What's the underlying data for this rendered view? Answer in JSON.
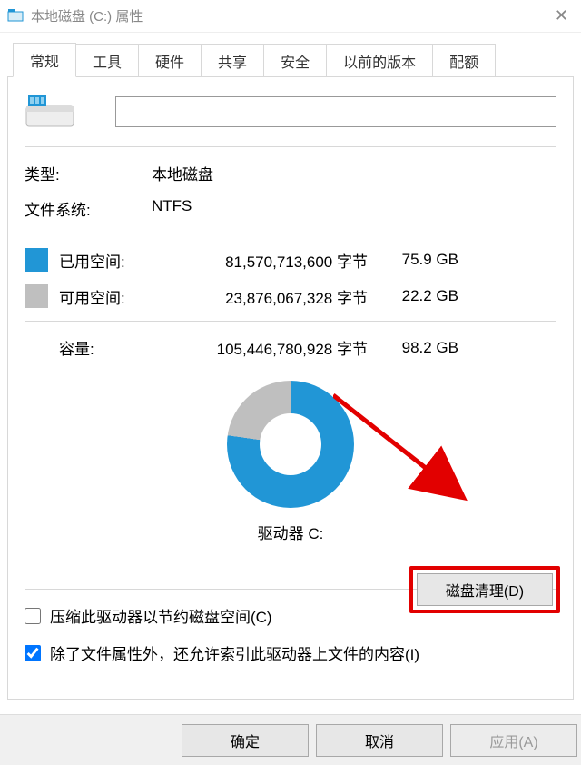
{
  "window": {
    "title": "本地磁盘 (C:) 属性"
  },
  "tabs": [
    "常规",
    "工具",
    "硬件",
    "共享",
    "安全",
    "以前的版本",
    "配额"
  ],
  "active_tab_index": 0,
  "drive": {
    "name_value": "",
    "type_label": "类型:",
    "type_value": "本地磁盘",
    "fs_label": "文件系统:",
    "fs_value": "NTFS",
    "used_label": "已用空间:",
    "used_bytes": "81,570,713,600 字节",
    "used_hr": "75.9 GB",
    "free_label": "可用空间:",
    "free_bytes": "23,876,067,328 字节",
    "free_hr": "22.2 GB",
    "capacity_label": "容量:",
    "capacity_bytes": "105,446,780,928 字节",
    "capacity_hr": "98.2 GB",
    "drive_label": "驱动器 C:"
  },
  "chart_data": {
    "type": "pie",
    "title": "",
    "series": [
      {
        "name": "已用空间",
        "value": 75.9,
        "color": "#2196d6"
      },
      {
        "name": "可用空间",
        "value": 22.2,
        "color": "#bfbfbf"
      }
    ]
  },
  "cleanup_button": "磁盘清理(D)",
  "compress_checkbox": {
    "checked": false,
    "label": "压缩此驱动器以节约磁盘空间(C)"
  },
  "index_checkbox": {
    "checked": true,
    "label": "除了文件属性外，还允许索引此驱动器上文件的内容(I)"
  },
  "buttons": {
    "ok": "确定",
    "cancel": "取消",
    "apply": "应用(A)"
  },
  "colors": {
    "used": "#2196d6",
    "free": "#bfbfbf",
    "highlight": "#e20000"
  }
}
